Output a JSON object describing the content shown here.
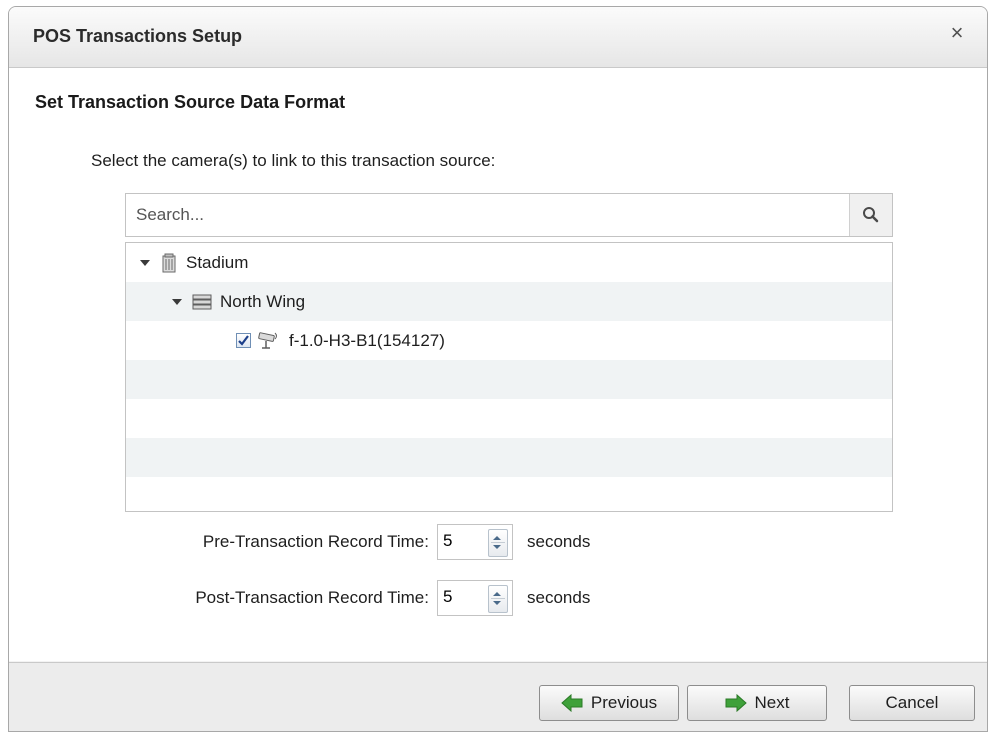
{
  "window": {
    "title": "POS Transactions Setup",
    "close_glyph": "×"
  },
  "section": {
    "title": "Set Transaction Source Data Format"
  },
  "prompt": "Select the camera(s) to link to this transaction source:",
  "search": {
    "placeholder": "Search...",
    "value": "",
    "icon": "search-icon"
  },
  "tree": {
    "items": [
      {
        "label": "Stadium",
        "icon": "building-icon",
        "expanded": true
      },
      {
        "label": "North Wing",
        "icon": "server-icon",
        "expanded": true
      },
      {
        "label": "f-1.0-H3-B1(154127)",
        "icon": "camera-icon",
        "checked": true
      }
    ]
  },
  "fields": {
    "pre": {
      "label": "Pre-Transaction Record Time:",
      "value": "5",
      "unit": "seconds"
    },
    "post": {
      "label": "Post-Transaction Record Time:",
      "value": "5",
      "unit": "seconds"
    }
  },
  "buttons": {
    "previous": "Previous",
    "next": "Next",
    "cancel": "Cancel"
  },
  "colors": {
    "arrow_green": "#3fa13a",
    "row_alt": "#f0f3f4",
    "checkbox_border": "#6f8fb5"
  }
}
